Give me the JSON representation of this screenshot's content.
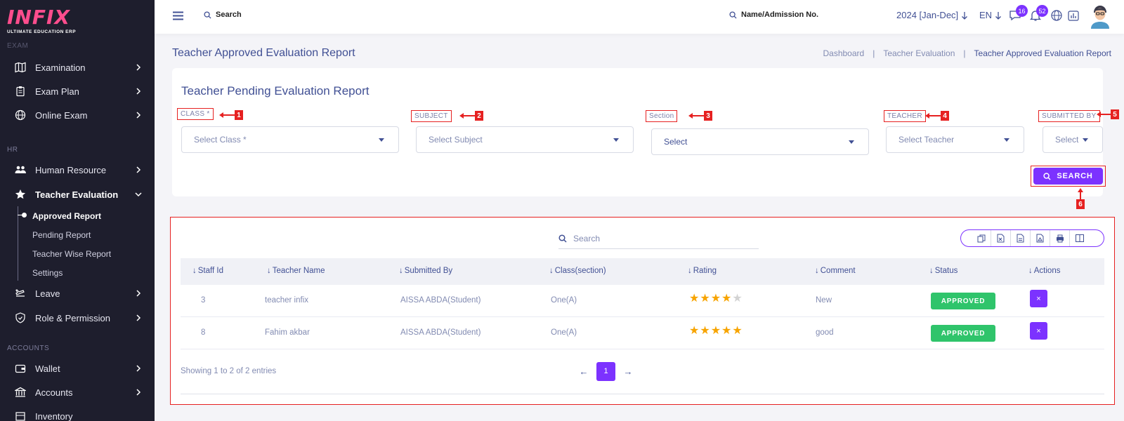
{
  "brand": {
    "logo": "INFIX",
    "tagline": "ULTIMATE EDUCATION ERP",
    "accent": "#7c32ff",
    "sidebar_bg": "#1e1e2d",
    "annotation_color": "#e62121"
  },
  "sidebar": {
    "section_exam": "EXAM",
    "section_hr": "HR",
    "section_accounts": "ACCOUNTS",
    "items": [
      {
        "label": "Examination",
        "icon": "map-icon"
      },
      {
        "label": "Exam Plan",
        "icon": "clipboard-icon"
      },
      {
        "label": "Online Exam",
        "icon": "globe-icon"
      },
      {
        "label": "Human Resource",
        "icon": "users-icon"
      },
      {
        "label": "Teacher Evaluation",
        "icon": "star-icon"
      },
      {
        "label": "Leave",
        "icon": "airplane-icon"
      },
      {
        "label": "Role & Permission",
        "icon": "shield-icon"
      },
      {
        "label": "Wallet",
        "icon": "wallet-icon"
      },
      {
        "label": "Accounts",
        "icon": "bank-icon"
      },
      {
        "label": "Inventory",
        "icon": "box-icon"
      }
    ],
    "sub_items": [
      "Approved Report",
      "Pending Report",
      "Teacher Wise Report",
      "Settings"
    ]
  },
  "header": {
    "search_label": "Search",
    "student_search_label": "Name/Admission No.",
    "session": "2024 [Jan-Dec]",
    "language": "EN",
    "messages_count": "16",
    "notifications_count": "52"
  },
  "page": {
    "title": "Teacher Approved Evaluation Report",
    "breadcrumb": [
      "Dashboard",
      "Teacher Evaluation",
      "Teacher Approved Evaluation Report"
    ]
  },
  "filter": {
    "title": "Teacher Pending Evaluation Report",
    "fields": [
      {
        "label": "CLASS *",
        "placeholder": "Select Class *",
        "annotation": "1"
      },
      {
        "label": "SUBJECT",
        "placeholder": "Select Subject",
        "annotation": "2"
      },
      {
        "label": "Section",
        "placeholder": "Select",
        "annotation": "3"
      },
      {
        "label": "TEACHER",
        "placeholder": "Select Teacher",
        "annotation": "4"
      },
      {
        "label": "SUBMITTED BY",
        "placeholder": "Select",
        "annotation": "5"
      }
    ],
    "search_button": "SEARCH",
    "search_annotation": "6"
  },
  "table": {
    "search_placeholder": "Search",
    "toolbar_icons": [
      "copy-icon",
      "excel-icon",
      "csv-icon",
      "pdf-icon",
      "print-icon",
      "columns-icon"
    ],
    "columns": [
      "Staff Id",
      "Teacher Name",
      "Submitted By",
      "Class(section)",
      "Rating",
      "Comment",
      "Status",
      "Actions"
    ],
    "rows": [
      {
        "staff_id": "3",
        "teacher": "teacher infix",
        "submitted_by": "AISSA ABDA(Student)",
        "class_section": "One(A)",
        "rating": 4,
        "comment": "New",
        "status": "APPROVED",
        "action": "×"
      },
      {
        "staff_id": "8",
        "teacher": "Fahim akbar",
        "submitted_by": "AISSA ABDA(Student)",
        "class_section": "One(A)",
        "rating": 5,
        "comment": "good",
        "status": "APPROVED",
        "action": "×"
      }
    ],
    "showing": "Showing 1 to 2 of 2 entries",
    "current_page": "1",
    "prev": "←",
    "next": "→"
  }
}
